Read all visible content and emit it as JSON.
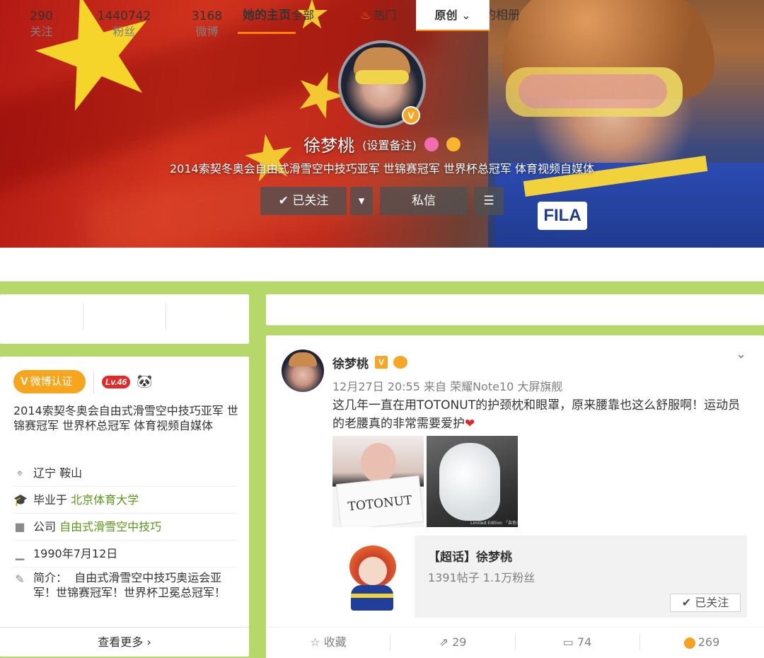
{
  "profile": {
    "name": "徐梦桃",
    "remark": "(设置备注)",
    "description": "2014索契冬奥会自由式滑雪空中技巧亚军 世锦赛冠军 世界杯总冠军 体育视频自媒体",
    "buttons": {
      "follow": "已关注",
      "message": "私信"
    },
    "verified_mark": "V"
  },
  "tabs": [
    {
      "label": "她的主页",
      "active": true
    },
    {
      "label": "她的相册",
      "active": false
    }
  ],
  "stats": [
    {
      "value": "290",
      "label": "关注"
    },
    {
      "value": "1440742",
      "label": "粉丝"
    },
    {
      "value": "3168",
      "label": "微博"
    }
  ],
  "info": {
    "badge": "微博认证",
    "badge_mark": "V",
    "level": "Lv.46",
    "bio": "2014索契冬奥会自由式滑雪空中技巧亚军 世锦赛冠军 世界杯总冠军 体育视频自媒体",
    "location": "辽宁 鞍山",
    "school_prefix": "毕业于",
    "school": "北京体育大学",
    "company_prefix": "公司",
    "company": "自由式滑雪空中技巧",
    "birthday": "1990年7月12日",
    "intro_label": "简介：",
    "intro": "自由式滑雪空中技巧奥运会亚军！世锦赛冠军！世界杯卫冕总冠军！",
    "more": "查看更多"
  },
  "filters": [
    {
      "label": "全部"
    },
    {
      "label": "热门"
    },
    {
      "label": "原创",
      "active": true
    }
  ],
  "post": {
    "author": "徐梦桃",
    "verified_mark": "V",
    "meta": "12月27日 20:55 来自 荣耀Note10 大屏旗舰",
    "text": "这几年一直在用TOTONUT的护颈枕和眼罩，原来腰靠也这么舒服啊！运动员的老腰真的非常需要爱护",
    "image1_text": "TOTONUT",
    "image2_caption": "Limited Edition 「自色中世限省脱定家」",
    "topic": {
      "title": "【超话】徐梦桃",
      "subtitle": "1391帖子 1.1万粉丝",
      "button": "已关注"
    },
    "actions": {
      "favorite": "收藏",
      "share": "29",
      "comment": "74",
      "like": "269"
    }
  },
  "colors": {
    "accent": "#ff8200",
    "link": "#5a9916",
    "page_bg": "#b6d76a",
    "badge": "#f6a51d"
  },
  "icons": [
    "check-icon",
    "chevron-down-icon",
    "menu-icon",
    "location-icon",
    "graduation-icon",
    "briefcase-icon",
    "cake-icon",
    "edit-icon",
    "chevron-right-icon",
    "flame-icon",
    "star-icon",
    "share-icon",
    "comment-icon",
    "like-icon",
    "heart-icon",
    "panda-icon"
  ]
}
